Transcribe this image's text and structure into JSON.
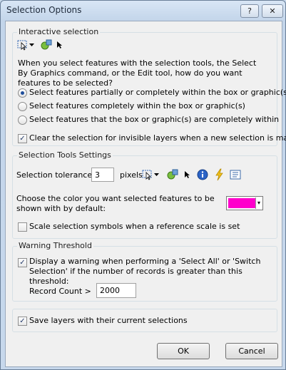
{
  "window": {
    "title": "Selection Options",
    "help_glyph": "?",
    "close_glyph": "✕"
  },
  "interactive": {
    "legend": "Interactive selection",
    "question": "When you select features with the selection tools, the Select By Graphics command, or the Edit tool, how do you want features to be selected?",
    "options": [
      {
        "label": "Select features partially or completely within the box or graphic(s)",
        "selected": true
      },
      {
        "label": "Select features completely within the box or graphic(s)",
        "selected": false
      },
      {
        "label": "Select features that the box or graphic(s) are completely within",
        "selected": false
      }
    ],
    "clear_label": "Clear the selection for invisible layers when a new selection is made",
    "clear_checked": true
  },
  "tools": {
    "legend": "Selection Tools Settings",
    "tolerance_label": "Selection tolerance:",
    "tolerance_value": "3",
    "pixels_label": "pixels",
    "color_label": "Choose the color you want selected features to be shown with by default:",
    "color": "#ff00cc",
    "scale_label": "Scale selection symbols when a reference scale is set",
    "scale_checked": false
  },
  "warning": {
    "legend": "Warning Threshold",
    "display_label": "Display a warning when performing a 'Select All' or 'Switch Selection' if the number of records is greater than this threshold:",
    "display_checked": true,
    "record_label": "Record Count >",
    "record_value": "2000"
  },
  "save": {
    "label": "Save layers with their current selections",
    "checked": true
  },
  "buttons": {
    "ok": "OK",
    "cancel": "Cancel"
  },
  "check_glyph": "✓",
  "icons": [
    "select-by-rectangle-icon",
    "select-elements-icon",
    "select-arrow-icon",
    "identify-icon",
    "flash-icon",
    "attributes-icon"
  ]
}
